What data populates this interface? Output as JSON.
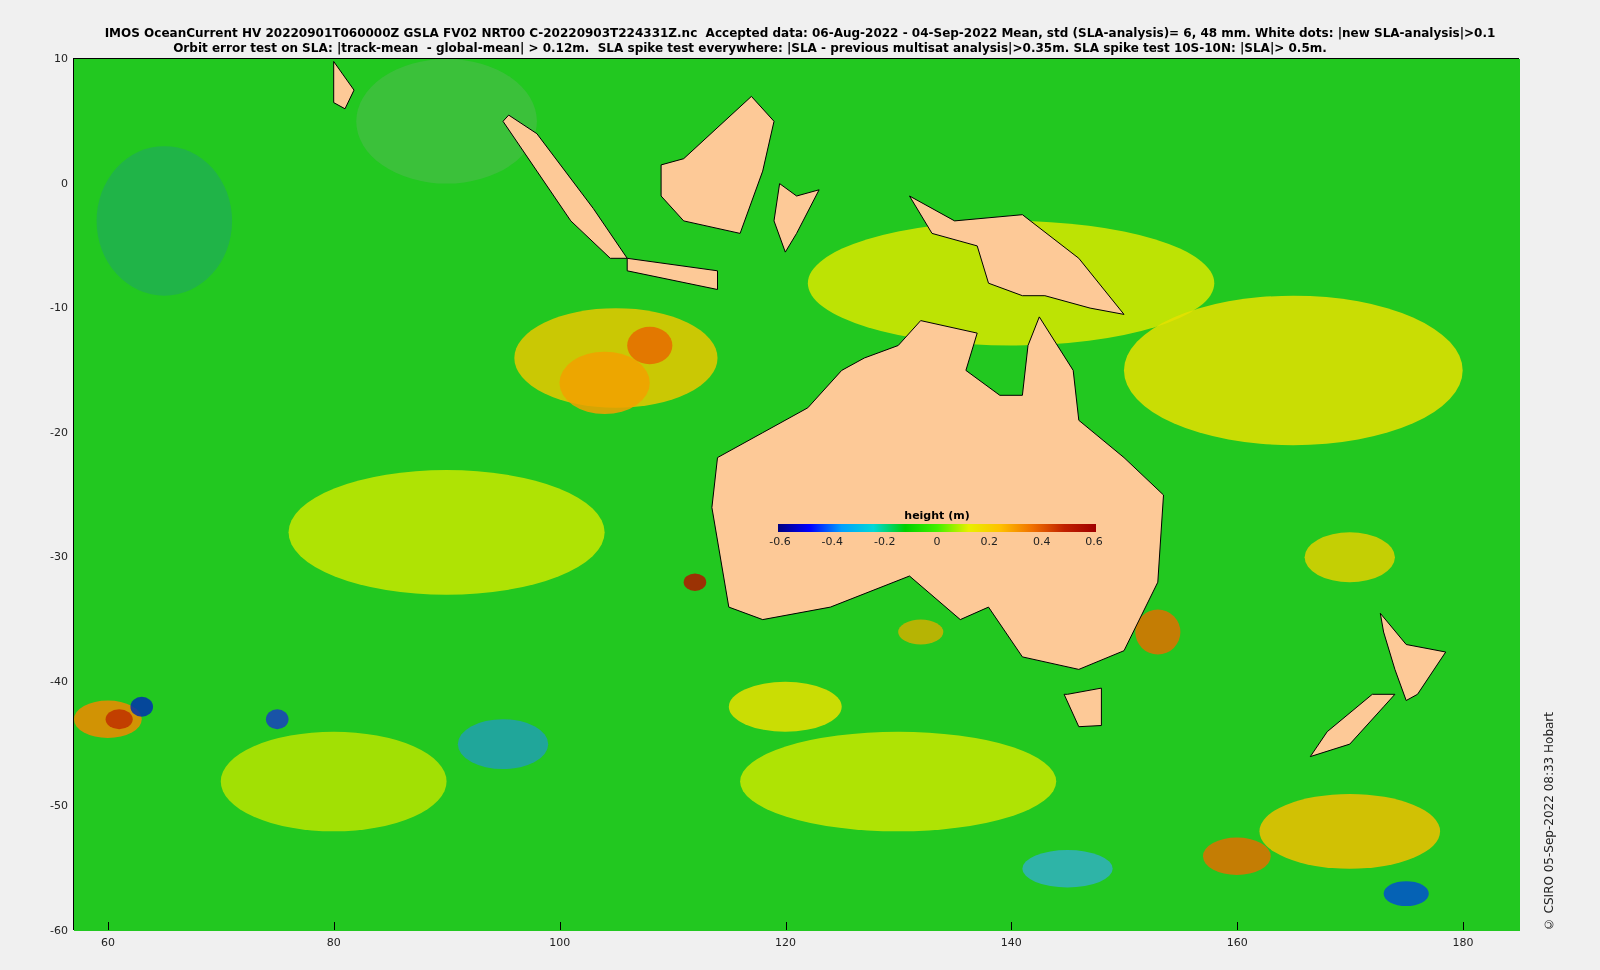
{
  "title_lines": [
    "IMOS OceanCurrent HV 20220901T060000Z GSLA FV02 NRT00 C-20220903T224331Z.nc  Accepted data: 06-Aug-2022 - 04-Sep-2022 Mean, std (SLA-analysis)= 6, 48 mm. White dots: |new SLA-analysis|>0.1",
    "Orbit error test on SLA: |track-mean  - global-mean| > 0.12m.  SLA spike test everywhere: |SLA - previous multisat analysis|>0.35m. SLA spike test 10S-10N: |SLA|> 0.5m."
  ],
  "map": {
    "x_ticks": [
      "60",
      "80",
      "100",
      "120",
      "140",
      "160",
      "180"
    ],
    "y_ticks": [
      "10",
      "0",
      "-10",
      "-20",
      "-30",
      "-40",
      "-50",
      "-60"
    ]
  },
  "colorbar": {
    "label": "height (m)",
    "ticks": [
      "-0.6",
      "-0.4",
      "-0.2",
      "0",
      "0.2",
      "0.4",
      "0.6"
    ]
  },
  "credit": "© CSIRO 05-Sep-2022 08:33 Hobart"
}
